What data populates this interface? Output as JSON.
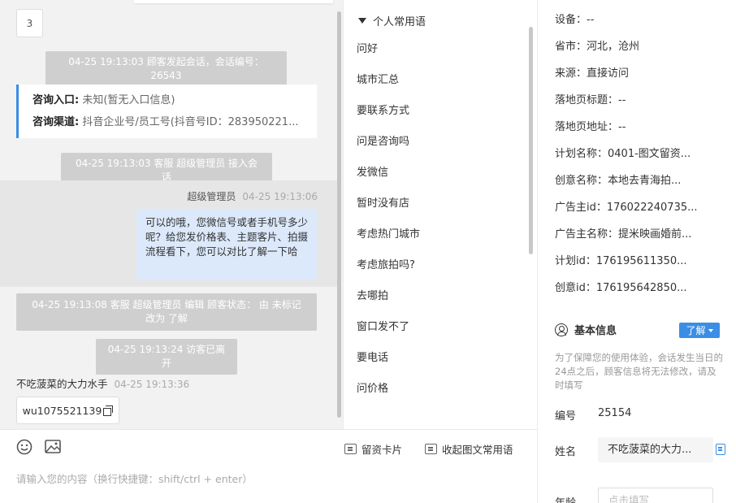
{
  "chat": {
    "unread_count": "3",
    "system_messages": {
      "session_start": "04-25 19:13:03 顾客发起会话，会话编号：26543",
      "agent_join": "04-25 19:13:03 客服 超级管理员 接入会话",
      "edit_status": "04-25 19:13:08 客服 超级管理员 编辑 顾客状态： 由 未标记 改为 了解",
      "visitor_left": "04-25 19:13:24 访客已离开"
    },
    "info_card": {
      "entry_label": "咨询入口:",
      "entry_value": "未知(暂无入口信息)",
      "channel_label": "咨询渠道:",
      "channel_value": "抖音企业号/员工号(抖音号ID：283950221..."
    },
    "agent_message": {
      "name": "超级管理员",
      "time": "04-25 19:13:06",
      "text": "可以的哦，您微信号或者手机号多少呢？给您发价格表、主题客片、拍摄流程看下，您可以对比了解一下哈"
    },
    "visitor_message": {
      "name": "不吃菠菜的大力水手",
      "time": "04-25 19:13:36",
      "text": "wu1075521139"
    }
  },
  "composer": {
    "emoji_icon": "smile-icon",
    "image_icon": "image-icon",
    "card_button": "留资卡片",
    "collapse_button": "收起图文常用语",
    "placeholder": "请输入您的内容（换行快捷键：shift/ctrl + enter）"
  },
  "phrases": {
    "header": "个人常用语",
    "items": [
      "问好",
      "城市汇总",
      "要联系方式",
      "问是咨询吗",
      "发微信",
      "暂时没有店",
      "考虑热门城市",
      "考虑旅拍吗?",
      "去哪拍",
      "窗口发不了",
      "要电话",
      "问价格"
    ]
  },
  "detail": {
    "fields": [
      "设备：--",
      "省市：河北，沧州",
      "来源：直接访问",
      "落地页标题：--",
      "落地页地址：--",
      "计划名称：0401-图文留资...",
      "创意名称：本地去青海拍...",
      "广告主id：176022240735...",
      "广告主名称：提米映画婚前...",
      "计划id：176195611350...",
      "创意id：176195642850..."
    ],
    "basic_info_title": "基本信息",
    "status_select": "了解",
    "notice": "为了保障您的使用体验，会话发生当日的24点之后，顾客信息将无法修改，请及时填写",
    "id_label": "编号",
    "id_value": "25154",
    "name_label": "姓名",
    "name_value": "不吃菠菜的大力...",
    "age_label": "年龄",
    "age_placeholder": "点击填写"
  },
  "colors": {
    "accent": "#3a8ee6",
    "agent_bubble": "#dce9fb",
    "system_bubble": "#cfcfcf",
    "chat_bg": "#f2f2f2"
  }
}
